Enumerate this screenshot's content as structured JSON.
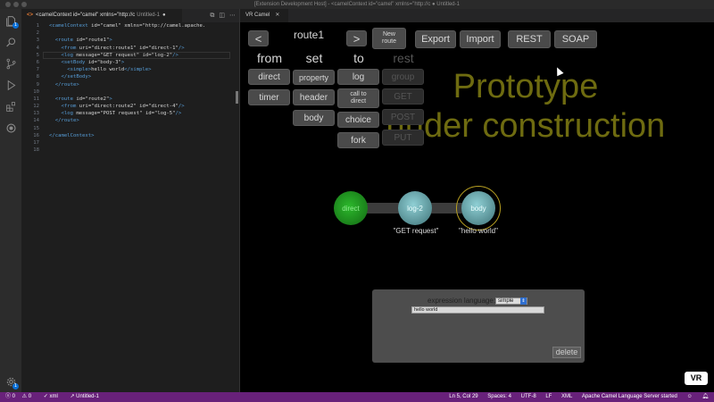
{
  "window": {
    "title": "[Extension Development Host] - <camelContext id=\"camel\" xmlns=\"http://c ● Untitled-1"
  },
  "editor": {
    "tab_title": "<camelContext id=\"camel\" xmlns=\"http://c",
    "tab_subtitle": "Untitled-1",
    "tab_dirty": "●",
    "lines": [
      {
        "n": "1",
        "text": "<camelContext id=\"camel\" xmlns=\"http://camel.apache."
      },
      {
        "n": "2",
        "text": ""
      },
      {
        "n": "3",
        "text": "  <route id=\"route1\">"
      },
      {
        "n": "4",
        "text": "    <from uri=\"direct:route1\" id=\"direct-1\"/>"
      },
      {
        "n": "5",
        "text": "    <log message=\"GET request\" id=\"log-2\"/>"
      },
      {
        "n": "6",
        "text": "    <setBody id=\"body-3\">"
      },
      {
        "n": "7",
        "text": "      <simple>hello world</simple>"
      },
      {
        "n": "8",
        "text": "    </setBody>"
      },
      {
        "n": "9",
        "text": "  </route>"
      },
      {
        "n": "10",
        "text": ""
      },
      {
        "n": "11",
        "text": "  <route id=\"route2\">"
      },
      {
        "n": "12",
        "text": "    <from uri=\"direct:route2\" id=\"direct-4\"/>"
      },
      {
        "n": "13",
        "text": "    <log message=\"POST request\" id=\"log-5\"/>"
      },
      {
        "n": "14",
        "text": "  </route>"
      },
      {
        "n": "15",
        "text": ""
      },
      {
        "n": "16",
        "text": "</camelContext>"
      },
      {
        "n": "17",
        "text": ""
      },
      {
        "n": "18",
        "text": ""
      }
    ]
  },
  "webview": {
    "tab_title": "VR Camel",
    "nav": {
      "prev": "<",
      "route_name": "route1",
      "next": ">",
      "new_route": "New route"
    },
    "actions": {
      "export": "Export",
      "import": "Import",
      "rest": "REST",
      "soap": "SOAP"
    },
    "columns": {
      "from": {
        "header": "from",
        "items": [
          "direct",
          "timer"
        ]
      },
      "set": {
        "header": "set",
        "items": [
          "property",
          "header",
          "body"
        ]
      },
      "to": {
        "header": "to",
        "items": [
          "log",
          "call to direct",
          "choice",
          "fork"
        ]
      },
      "rest": {
        "header": "rest",
        "items": [
          "group",
          "GET",
          "POST",
          "PUT"
        ]
      }
    },
    "banner": {
      "line1": "Prototype",
      "line2": "under construction"
    },
    "flow": {
      "nodes": [
        {
          "label": "direct",
          "caption": ""
        },
        {
          "label": "log-2",
          "caption": "\"GET request\""
        },
        {
          "label": "body",
          "caption": "\"hello world\""
        }
      ]
    },
    "expression_panel": {
      "label": "expression language:",
      "language": "simple",
      "value": "hello world",
      "delete": "delete"
    },
    "vr_button": "VR"
  },
  "statusbar": {
    "errors": "0",
    "warnings": "0",
    "language_check": "xml",
    "file": "Untitled-1",
    "position": "Ln 5, Col 29",
    "spaces": "Spaces: 4",
    "encoding": "UTF-8",
    "eol": "LF",
    "mode": "XML",
    "server": "Apache Camel Language Server started"
  },
  "colors": {
    "statusbar": "#68217a",
    "banner": "#6e6b10",
    "direct_node": "#1f8f1f",
    "node": "#5a8f95"
  }
}
